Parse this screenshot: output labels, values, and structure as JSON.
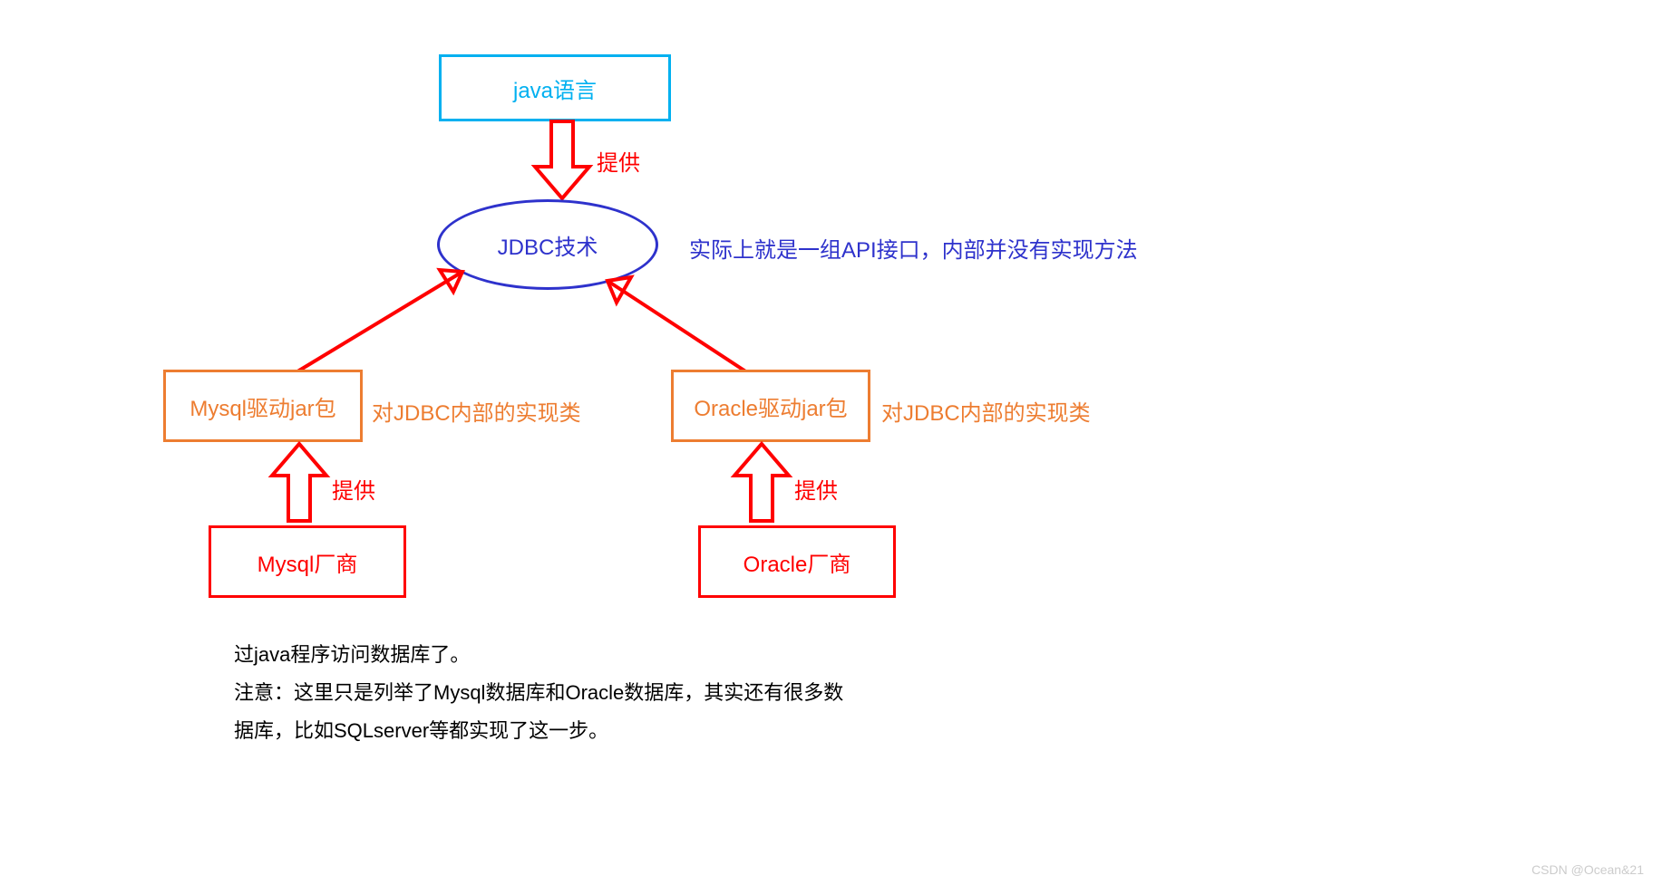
{
  "nodes": {
    "java": "java语言",
    "jdbc": "JDBC技术",
    "mysqlDriver": "Mysql驱动jar包",
    "oracleDriver": "Oracle驱动jar包",
    "mysqlVendor": "Mysql厂商",
    "oracleVendor": "Oracle厂商"
  },
  "labels": {
    "provideTop": "提供",
    "jdbcNote": "实际上就是一组API接口，内部并没有实现方法",
    "mysqlDriverNote": "对JDBC内部的实现类",
    "oracleDriverNote": "对JDBC内部的实现类",
    "provideMysql": "提供",
    "provideOracle": "提供"
  },
  "paragraph": {
    "line1": "过java程序访问数据库了。",
    "line2": "注意：这里只是列举了Mysql数据库和Oracle数据库，其实还有很多数",
    "line3": "据库，比如SQLserver等都实现了这一步。"
  },
  "watermark": "CSDN @Ocean&21",
  "colors": {
    "cyan": "#00B0F0",
    "orange": "#ED7D31",
    "red": "#FF0000",
    "blue": "#2E32CC"
  }
}
